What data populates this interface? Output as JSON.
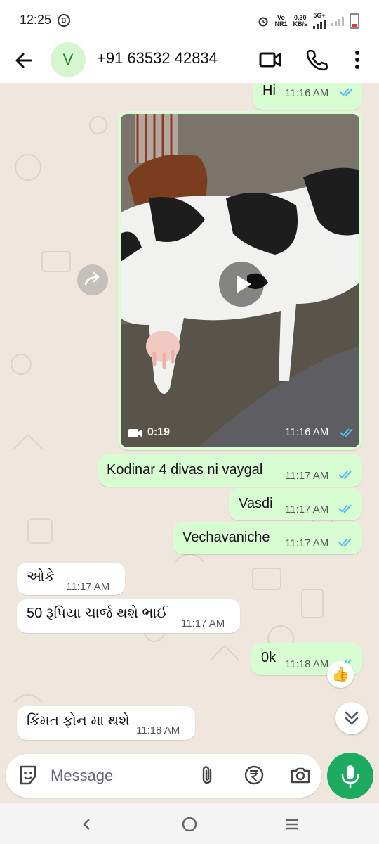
{
  "status_bar": {
    "time": "12:25",
    "app_icon_letter": "B",
    "network_top": "Vo",
    "network_bottom": "NR1",
    "speed_value": "0.30",
    "speed_unit": "KB/s",
    "network_type": "5G+"
  },
  "header": {
    "avatar_letter": "V",
    "contact_name": "+91 63532 42834"
  },
  "messages": [
    {
      "text": "Hi",
      "time": "11:16 AM"
    },
    {
      "text": "Kodinar 4 divas ni vaygal",
      "time": "11:17 AM"
    },
    {
      "text": "Vasdi",
      "time": "11:17 AM"
    },
    {
      "text": "Vechavaniche",
      "time": "11:17 AM"
    },
    {
      "text": "ઓકે",
      "time": "11:17 AM"
    },
    {
      "text": "50 રૂપિયા ચાર્જ થશે ભાઈ",
      "time": "11:17 AM"
    },
    {
      "text": "0k",
      "time": "11:18 AM"
    },
    {
      "text": "કિંમત ફોન મા થશે",
      "time": "11:18 AM"
    }
  ],
  "video": {
    "duration": "0:19",
    "time": "11:16 AM"
  },
  "reaction": "👍",
  "input": {
    "placeholder": "Message"
  },
  "colors": {
    "accent": "#1daa61",
    "outgoing_bubble": "#d9fdd3",
    "read_ticks": "#53bdeb"
  }
}
